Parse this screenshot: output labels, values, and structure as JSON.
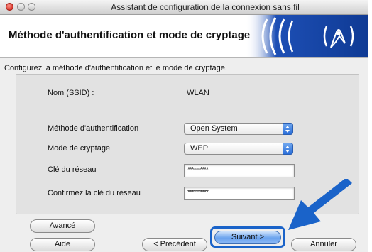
{
  "window": {
    "title": "Assistant de configuration de la connexion sans fil"
  },
  "header": {
    "title": "Méthode d'authentification et mode de cryptage",
    "logo": "wireless-signal-icon"
  },
  "instructions": "Configurez la méthode d'authentification et le mode de cryptage.",
  "form": {
    "ssid_label": "Nom (SSID) :",
    "ssid_value": "WLAN",
    "auth_label": "Méthode d'authentification",
    "auth_value": "Open System",
    "encryption_label": "Mode de cryptage",
    "encryption_value": "WEP",
    "key_label": "Clé du réseau",
    "key_value": "**********",
    "confirm_label": "Confirmez la clé du réseau",
    "confirm_value": "**********"
  },
  "buttons": {
    "advanced": "Avancé",
    "help": "Aide",
    "previous": "< Précédent",
    "next": "Suivant >",
    "cancel": "Annuler"
  },
  "colors": {
    "highlight": "#1a63c9",
    "accent": "#2c6fd9"
  }
}
